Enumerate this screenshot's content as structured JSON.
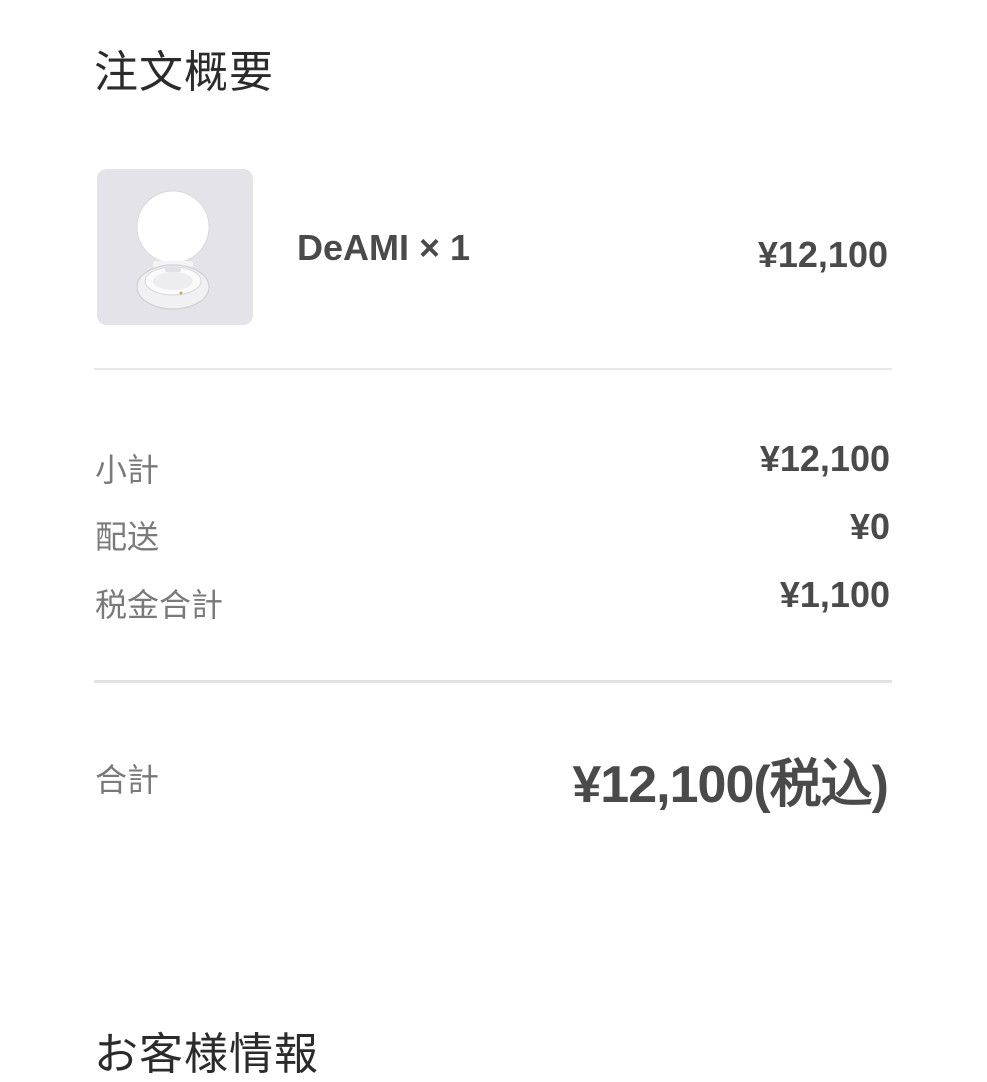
{
  "order_summary": {
    "title": "注文概要",
    "item": {
      "image_icon": "cushion-compact-product-image",
      "name": "DeAMI × 1",
      "price": "¥12,100"
    },
    "subtotal": {
      "label": "小計",
      "value": "¥12,100"
    },
    "shipping": {
      "label": "配送",
      "value": "¥0"
    },
    "tax": {
      "label": "税金合計",
      "value": "¥1,100"
    },
    "total": {
      "label": "合計",
      "value": "¥12,100(税込)"
    }
  },
  "customer_info": {
    "title": "お客様情報"
  }
}
